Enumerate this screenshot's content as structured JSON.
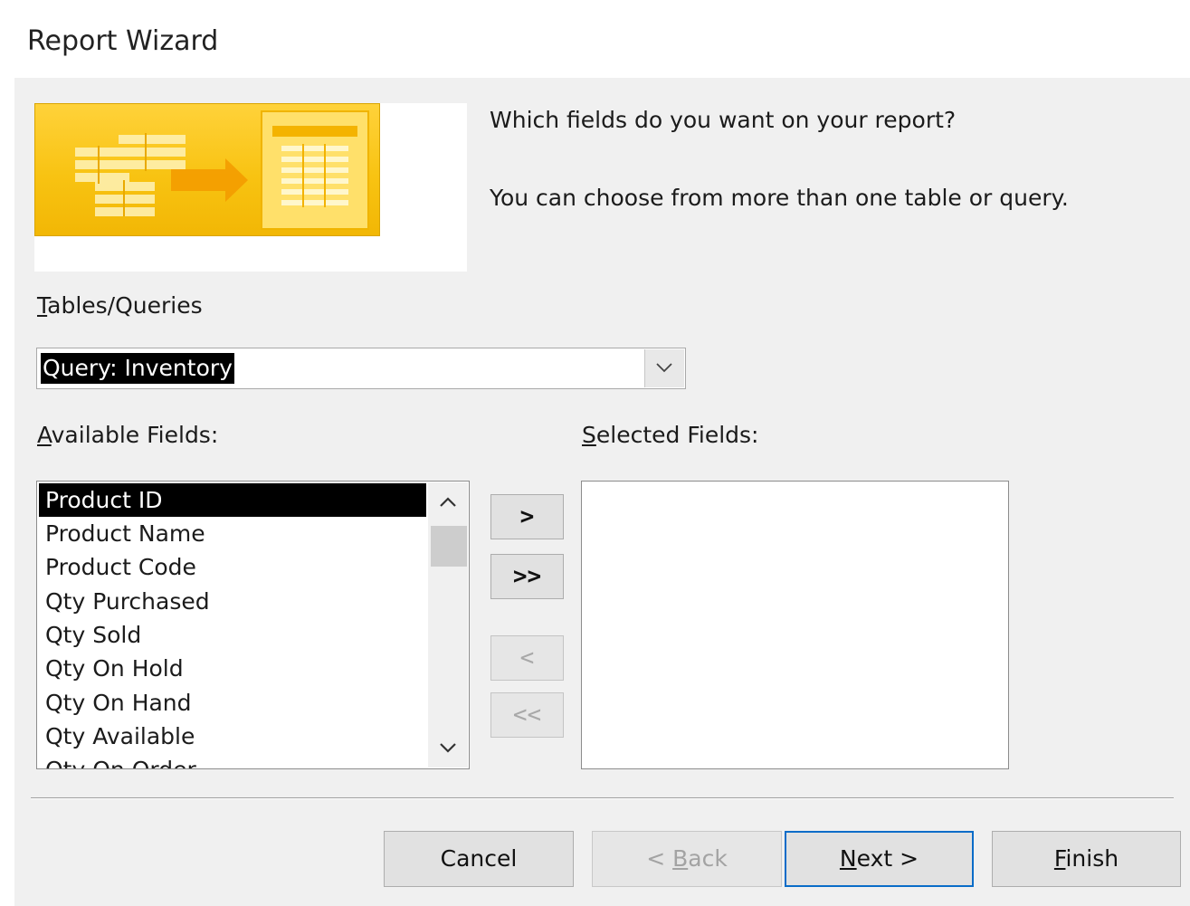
{
  "window": {
    "title": "Report Wizard"
  },
  "header": {
    "question": "Which fields do you want on your report?",
    "hint": "You can choose from more than one table or query."
  },
  "tables_queries": {
    "label_prefix": "T",
    "label_rest": "ables/Queries",
    "value": "Query: Inventory"
  },
  "available_fields": {
    "label_prefix": "A",
    "label_rest": "vailable Fields:",
    "items": [
      "Product ID",
      "Product Name",
      "Product Code",
      "Qty Purchased",
      "Qty Sold",
      "Qty On Hold",
      "Qty On Hand",
      "Qty Available",
      "Qty On Order"
    ],
    "selected_index": 0
  },
  "selected_fields": {
    "label_prefix": "S",
    "label_rest": "elected Fields:",
    "items": []
  },
  "move_buttons": {
    "add_one": ">",
    "add_all": ">>",
    "remove_one": "<",
    "remove_all": "<<"
  },
  "footer": {
    "cancel": "Cancel",
    "back_pre": "< ",
    "back_mnemonic": "B",
    "back_rest": "ack",
    "next_mnemonic": "N",
    "next_rest": "ext >",
    "finish_mnemonic": "F",
    "finish_rest": "inish"
  },
  "icons": {
    "banner": "report-wizard-banner-icon",
    "dropdown": "chevron-down-icon",
    "scroll_up": "chevron-up-icon",
    "scroll_down": "chevron-down-icon"
  },
  "colors": {
    "banner_yellow": "#f8c312",
    "default_button_border": "#0a6cc8",
    "selection": "#000000"
  }
}
